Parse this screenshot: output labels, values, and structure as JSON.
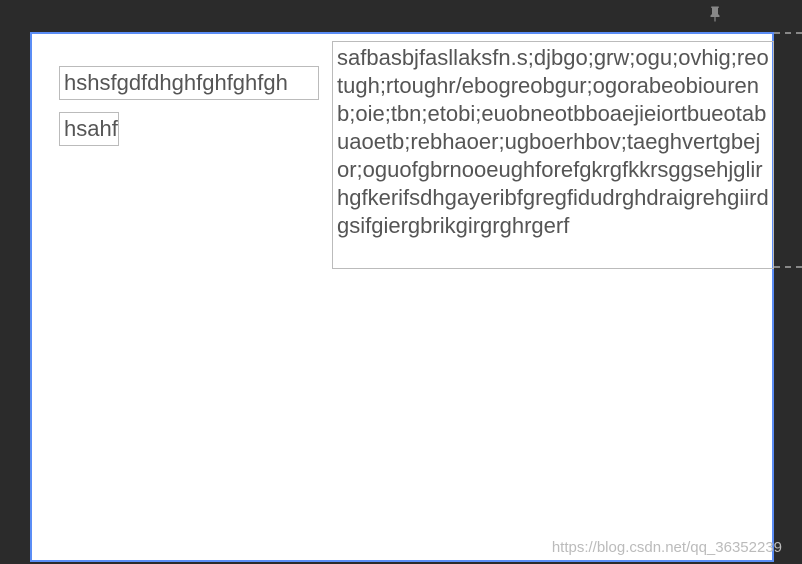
{
  "leftBox1": "hshsfgdfdhghfghfghfgh",
  "leftBox2": "hsahf",
  "rightBox": "safbasbjfasllaksfn.s;djbgo;grw;ogu;ovhig;reotugh;rtoughr/ebogreobgur;ogorabeobiourenb;oie;tbn;etobi;euobneotbboaejieiortbueotabuaoetb;rebhaoer;ugboerhbov;taeghvertgbejor;oguofgbrnooeughforefgkrgfkkrsggsehjglirhgfkerifsdhgayeribfgregfidudrghdraigrehgiirdgsifgiergbrikgirgrghrgerf",
  "watermark": "https://blog.csdn.net/qq_36352239"
}
